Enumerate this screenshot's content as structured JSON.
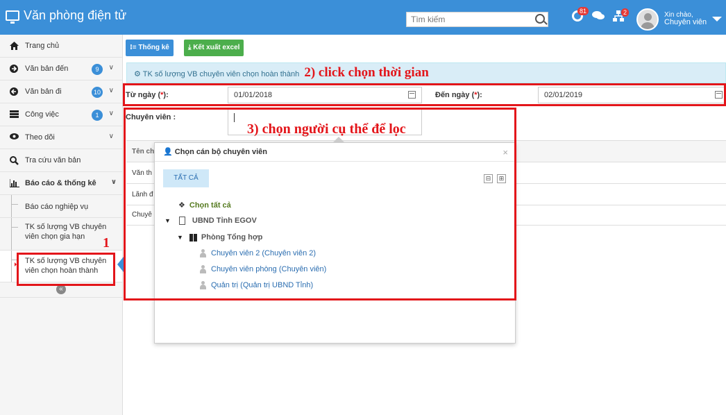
{
  "header": {
    "app_title": "Văn phòng điện tử",
    "search_placeholder": "Tìm kiếm",
    "notif_count_1": "81",
    "notif_count_2": "2",
    "greeting_line1": "Xin chào,",
    "greeting_line2": "Chuyên viên"
  },
  "sidebar": {
    "items": [
      {
        "label": "Trang chủ"
      },
      {
        "label": "Văn bản đến",
        "count": "9"
      },
      {
        "label": "Văn bản đi",
        "count": "10"
      },
      {
        "label": "Công việc",
        "count": "1"
      },
      {
        "label": "Theo dõi"
      },
      {
        "label": "Tra cứu văn bản"
      },
      {
        "label": "Báo cáo & thống kê"
      }
    ],
    "sub_items": [
      {
        "label": "Báo cáo nghiệp vụ"
      },
      {
        "label": "TK số lượng VB chuyên viên chọn gia hạn"
      },
      {
        "label": "TK số lượng VB chuyên viên chọn hoàn thành"
      }
    ],
    "collapse_label": "«"
  },
  "toolbar": {
    "stats_label": "Thống kê",
    "export_label": "Kết xuất excel"
  },
  "panel": {
    "title": "TK số lượng VB chuyên viên chọn hoàn thành"
  },
  "form": {
    "from_label": "Từ ngày (",
    "from_value": "01/01/2018",
    "to_label": "Đến ngày (",
    "to_value": "02/01/2019",
    "required_mark": "*",
    "label_close": "):",
    "specialist_label": "Chuyên viên :"
  },
  "table_behind": {
    "header": "Tên ch",
    "rows": [
      "Văn th",
      "Lãnh đ",
      "Chuyê"
    ]
  },
  "popup": {
    "title": "Chọn cán bộ chuyên viên",
    "close": "×",
    "select_all_btn": "TẤT CẢ",
    "collapse_btn": "⊟",
    "expand_btn": "⊞",
    "tree": {
      "select_all": "Chọn tất cả",
      "org": "UBND Tỉnh EGOV",
      "dept": "Phòng Tổng hợp",
      "people": [
        "Chuyên viên 2 (Chuyên viên 2)",
        "Chuyên viên phòng (Chuyên viên)",
        "Quản trị (Quản trị UBND Tỉnh)"
      ]
    }
  },
  "annotations": {
    "step1": "1",
    "step2": "2) click chọn thời gian",
    "step3": "3) chọn người cụ thể để lọc"
  },
  "colors": {
    "topbar": "#3b8fd8",
    "annotation_red": "#e3151a",
    "btn_blue": "#3b8fd8",
    "btn_green": "#4cae4c"
  }
}
